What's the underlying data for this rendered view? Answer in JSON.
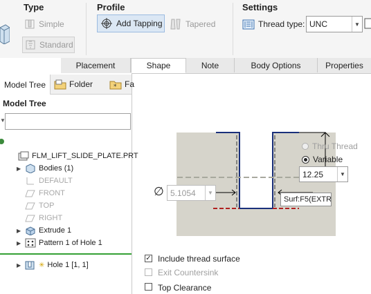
{
  "ribbon": {
    "type_group": {
      "title": "Type",
      "simple_label": "Simple",
      "standard_label": "Standard"
    },
    "profile_group": {
      "title": "Profile",
      "add_tapping_label": "Add Tapping",
      "tapered_label": "Tapered"
    },
    "settings_group": {
      "title": "Settings",
      "thread_type_label": "Thread type:",
      "thread_type_value": "UNC"
    }
  },
  "tabs": [
    "Placement",
    "Shape",
    "Note",
    "Body Options",
    "Properties"
  ],
  "active_tab": "Shape",
  "left_tabs": {
    "model_tree": "Model Tree",
    "folder": "Folder",
    "favorites": "Fa"
  },
  "model_tree": {
    "heading": "Model Tree",
    "search_value": "",
    "items": [
      {
        "label": "FLM_LIFT_SLIDE_PLATE.PRT",
        "icon": "part-icon",
        "dim": false,
        "caret": false,
        "indent": 0
      },
      {
        "label": "Bodies (1)",
        "icon": "bodies-icon",
        "dim": false,
        "caret": true,
        "indent": 1
      },
      {
        "label": "DEFAULT",
        "icon": "csys-icon",
        "dim": true,
        "caret": false,
        "indent": 1
      },
      {
        "label": "FRONT",
        "icon": "datum-plane-icon",
        "dim": true,
        "caret": false,
        "indent": 1
      },
      {
        "label": "TOP",
        "icon": "datum-plane-icon",
        "dim": true,
        "caret": false,
        "indent": 1
      },
      {
        "label": "RIGHT",
        "icon": "datum-plane-icon",
        "dim": true,
        "caret": false,
        "indent": 1
      },
      {
        "label": "Extrude 1",
        "icon": "extrude-icon",
        "dim": false,
        "caret": true,
        "indent": 1
      },
      {
        "label": "Pattern 1 of Hole 1",
        "icon": "pattern-icon",
        "dim": false,
        "caret": true,
        "indent": 1
      }
    ],
    "current_item": {
      "label": "Hole 1 [1, 1]",
      "icon": "hole-icon"
    }
  },
  "shape": {
    "thru_thread_label": "Thru Thread",
    "variable_label": "Variable",
    "depth_value": "12.25",
    "diameter_value": "5.1054",
    "surface_ref": "Surf:F5(EXTR"
  },
  "options": {
    "include_thread_surface": {
      "label": "Include thread surface",
      "checked": true,
      "enabled": true
    },
    "exit_countersink": {
      "label": "Exit Countersink",
      "checked": false,
      "enabled": false
    },
    "top_clearance": {
      "label": "Top Clearance",
      "checked": false,
      "enabled": true
    }
  }
}
